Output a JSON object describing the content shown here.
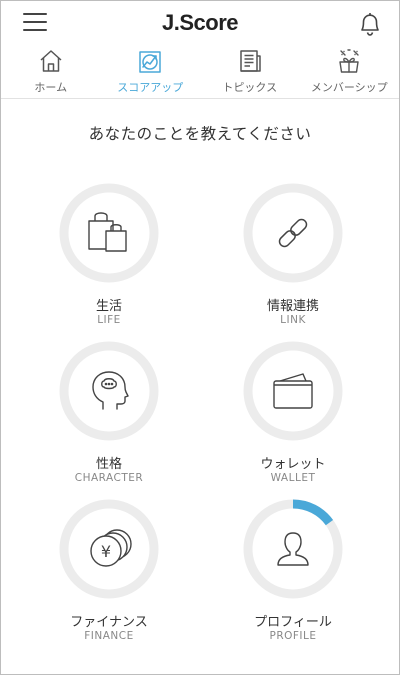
{
  "header": {
    "title": "J.Score"
  },
  "tabs": [
    {
      "label": "ホーム",
      "icon": "home-icon",
      "active": false
    },
    {
      "label": "スコアアップ",
      "icon": "score-up-icon",
      "active": true
    },
    {
      "label": "トピックス",
      "icon": "topics-icon",
      "active": false
    },
    {
      "label": "メンバーシップ",
      "icon": "membership-icon",
      "active": false
    }
  ],
  "main": {
    "question": "あなたのことを教えてください",
    "categories": [
      {
        "label": "生活",
        "sublabel": "LIFE",
        "icon": "shopping-bags-icon",
        "progress": 0
      },
      {
        "label": "情報連携",
        "sublabel": "LINK",
        "icon": "link-chain-icon",
        "progress": 0
      },
      {
        "label": "性格",
        "sublabel": "CHARACTER",
        "icon": "head-thought-icon",
        "progress": 0
      },
      {
        "label": "ウォレット",
        "sublabel": "WALLET",
        "icon": "wallet-icon",
        "progress": 0
      },
      {
        "label": "ファイナンス",
        "sublabel": "FINANCE",
        "icon": "yen-coins-icon",
        "progress": 0
      },
      {
        "label": "プロフィール",
        "sublabel": "PROFILE",
        "icon": "person-icon",
        "progress": 0.15
      }
    ]
  },
  "colors": {
    "accent": "#4aa8d8",
    "ring_track": "#ececec",
    "icon_stroke": "#444444"
  }
}
